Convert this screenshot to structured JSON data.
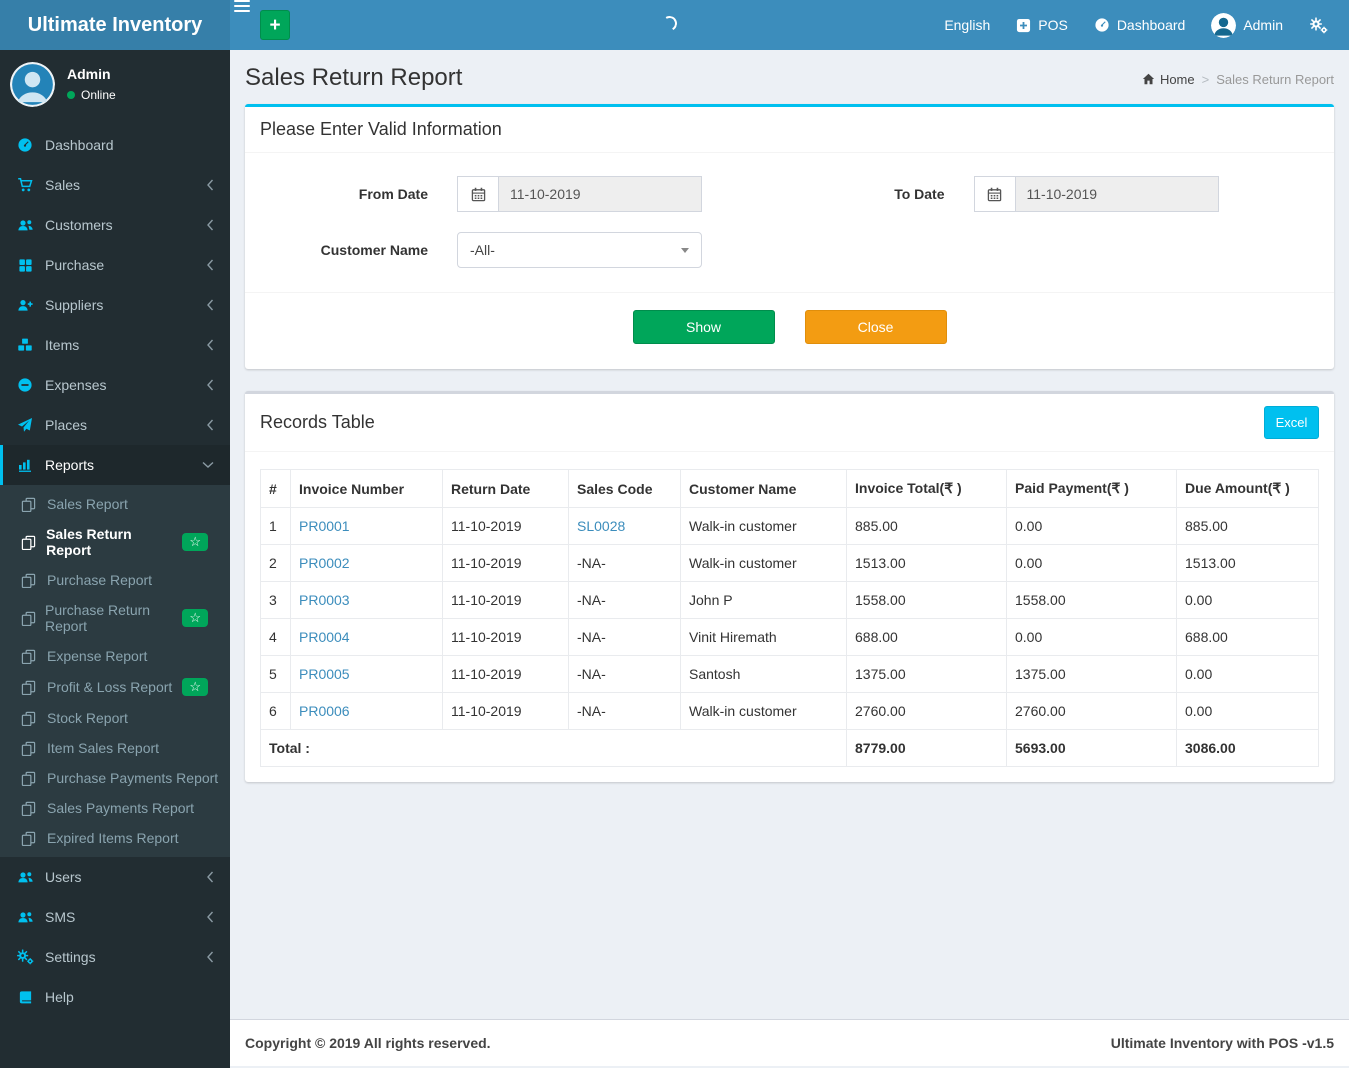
{
  "brand": {
    "title": "Ultimate Inventory"
  },
  "topbar": {
    "language": "English",
    "pos_label": "POS",
    "dashboard_label": "Dashboard",
    "user_label": "Admin"
  },
  "user_panel": {
    "name": "Admin",
    "status": "Online"
  },
  "sidebar": {
    "items": [
      {
        "label": "Dashboard"
      },
      {
        "label": "Sales"
      },
      {
        "label": "Customers"
      },
      {
        "label": "Purchase"
      },
      {
        "label": "Suppliers"
      },
      {
        "label": "Items"
      },
      {
        "label": "Expenses"
      },
      {
        "label": "Places"
      },
      {
        "label": "Reports"
      },
      {
        "label": "Users"
      },
      {
        "label": "SMS"
      },
      {
        "label": "Settings"
      },
      {
        "label": "Help"
      }
    ],
    "reports_submenu": [
      {
        "label": "Sales Report"
      },
      {
        "label": "Sales Return Report",
        "badge": true
      },
      {
        "label": "Purchase Report"
      },
      {
        "label": "Purchase Return Report",
        "badge": true
      },
      {
        "label": "Expense Report"
      },
      {
        "label": "Profit & Loss Report",
        "badge": true
      },
      {
        "label": "Stock Report"
      },
      {
        "label": "Item Sales Report"
      },
      {
        "label": "Purchase Payments Report"
      },
      {
        "label": "Sales Payments Report"
      },
      {
        "label": "Expired Items Report"
      }
    ]
  },
  "page": {
    "title": "Sales Return Report",
    "breadcrumb_home": "Home",
    "breadcrumb_sep": ">",
    "breadcrumb_current": "Sales Return Report"
  },
  "filter_panel": {
    "header": "Please Enter Valid Information",
    "from_date_label": "From Date",
    "from_date_value": "11-10-2019",
    "to_date_label": "To Date",
    "to_date_value": "11-10-2019",
    "customer_label": "Customer Name",
    "customer_value": "-All-",
    "show_button": "Show",
    "close_button": "Close"
  },
  "records": {
    "header": "Records Table",
    "excel_button": "Excel",
    "columns": [
      "#",
      "Invoice Number",
      "Return Date",
      "Sales Code",
      "Customer Name",
      "Invoice Total(₹ )",
      "Paid Payment(₹ )",
      "Due Amount(₹ )"
    ],
    "rows": [
      {
        "num": "1",
        "invoice": "PR0001",
        "date": "11-10-2019",
        "sales_code": "SL0028",
        "customer": "Walk-in customer",
        "total": "885.00",
        "paid": "0.00",
        "due": "885.00"
      },
      {
        "num": "2",
        "invoice": "PR0002",
        "date": "11-10-2019",
        "sales_code": "-NA-",
        "customer": "Walk-in customer",
        "total": "1513.00",
        "paid": "0.00",
        "due": "1513.00"
      },
      {
        "num": "3",
        "invoice": "PR0003",
        "date": "11-10-2019",
        "sales_code": "-NA-",
        "customer": "John P",
        "total": "1558.00",
        "paid": "1558.00",
        "due": "0.00"
      },
      {
        "num": "4",
        "invoice": "PR0004",
        "date": "11-10-2019",
        "sales_code": "-NA-",
        "customer": "Vinit Hiremath",
        "total": "688.00",
        "paid": "0.00",
        "due": "688.00"
      },
      {
        "num": "5",
        "invoice": "PR0005",
        "date": "11-10-2019",
        "sales_code": "-NA-",
        "customer": "Santosh",
        "total": "1375.00",
        "paid": "1375.00",
        "due": "0.00"
      },
      {
        "num": "6",
        "invoice": "PR0006",
        "date": "11-10-2019",
        "sales_code": "-NA-",
        "customer": "Walk-in customer",
        "total": "2760.00",
        "paid": "2760.00",
        "due": "0.00"
      }
    ],
    "total_label": "Total :",
    "total_invoice": "8779.00",
    "total_paid": "5693.00",
    "total_due": "3086.00"
  },
  "footer": {
    "left": "Copyright © 2019 All rights reserved.",
    "right": "Ultimate Inventory with POS -v1.5"
  },
  "icons": {
    "star": "☆",
    "hamburger": "☰",
    "plus": "+",
    "caret_down": "▼",
    "map": {
      "pos-icon": "plus-square",
      "dashboard-icon": "gauge",
      "gears-icon": "cogs",
      "cart-icon": "shopping-cart",
      "users-icon": "user-group",
      "grid-icon": "th-large",
      "user-plus-icon": "user-plus",
      "cubes-icon": "cubes",
      "minus-circle-icon": "minus-circle",
      "paper-plane-icon": "send",
      "bar-chart-icon": "bars-with-baseline",
      "copy-icon": "two-pages",
      "book-icon": "book",
      "calendar-icon": "calendar",
      "home-icon": "house",
      "loading-spinner": "arc"
    }
  },
  "colors": {
    "navbar": "#3c8dbc",
    "logo_bg": "#367fa9",
    "sidebar_bg": "#222d32",
    "submenu_bg": "#2c3b41",
    "sidebar_icon": "#00c0ef",
    "info": "#00c0ef",
    "success": "#00a65a",
    "warning": "#f39c12",
    "content_bg": "#ecf0f5",
    "link": "#3c8dbc"
  }
}
